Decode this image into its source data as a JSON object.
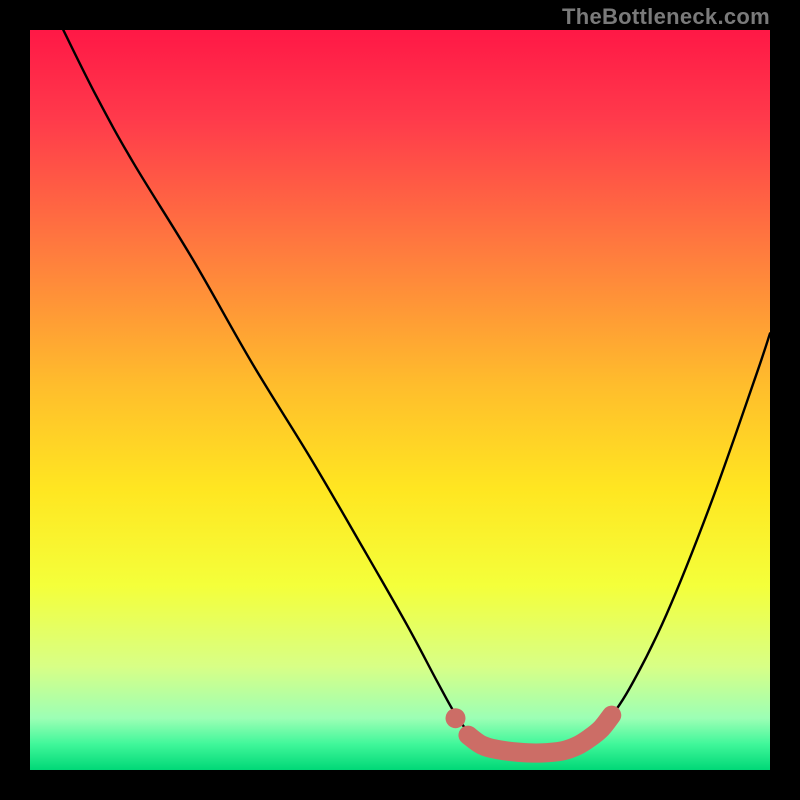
{
  "watermark": {
    "text": "TheBottleneck.com"
  },
  "chart_data": {
    "type": "line",
    "title": "",
    "xlabel": "",
    "ylabel": "",
    "xlim": [
      0,
      100
    ],
    "ylim": [
      0,
      100
    ],
    "grid": false,
    "legend": false,
    "background_gradient_stops": [
      {
        "offset": 0.0,
        "color": "#ff1846"
      },
      {
        "offset": 0.12,
        "color": "#ff3a4b"
      },
      {
        "offset": 0.3,
        "color": "#ff7c3e"
      },
      {
        "offset": 0.48,
        "color": "#ffbd2c"
      },
      {
        "offset": 0.62,
        "color": "#ffe621"
      },
      {
        "offset": 0.75,
        "color": "#f4ff3a"
      },
      {
        "offset": 0.86,
        "color": "#d8ff86"
      },
      {
        "offset": 0.93,
        "color": "#9cffb5"
      },
      {
        "offset": 0.965,
        "color": "#40f79a"
      },
      {
        "offset": 1.0,
        "color": "#00d877"
      }
    ],
    "curve_points": [
      {
        "x": 4.5,
        "y": 100.0
      },
      {
        "x": 9.0,
        "y": 91.0
      },
      {
        "x": 14.0,
        "y": 82.0
      },
      {
        "x": 22.0,
        "y": 69.0
      },
      {
        "x": 30.0,
        "y": 55.0
      },
      {
        "x": 38.0,
        "y": 42.0
      },
      {
        "x": 45.0,
        "y": 30.0
      },
      {
        "x": 51.0,
        "y": 19.5
      },
      {
        "x": 55.0,
        "y": 12.0
      },
      {
        "x": 57.5,
        "y": 7.5
      },
      {
        "x": 59.5,
        "y": 4.8
      },
      {
        "x": 61.0,
        "y": 3.5
      },
      {
        "x": 63.0,
        "y": 2.8
      },
      {
        "x": 66.0,
        "y": 2.4
      },
      {
        "x": 69.0,
        "y": 2.3
      },
      {
        "x": 72.0,
        "y": 2.6
      },
      {
        "x": 74.0,
        "y": 3.3
      },
      {
        "x": 75.5,
        "y": 4.2
      },
      {
        "x": 77.5,
        "y": 6.0
      },
      {
        "x": 81.0,
        "y": 11.0
      },
      {
        "x": 86.0,
        "y": 21.0
      },
      {
        "x": 92.0,
        "y": 36.0
      },
      {
        "x": 98.0,
        "y": 53.0
      },
      {
        "x": 100.0,
        "y": 59.0
      }
    ],
    "highlight": {
      "color": "#cc6d66",
      "dot": {
        "x": 57.5,
        "y": 7.0,
        "r": 1.35
      },
      "stroke_points": [
        {
          "x": 59.2,
          "y": 4.7
        },
        {
          "x": 61.0,
          "y": 3.4
        },
        {
          "x": 63.0,
          "y": 2.8
        },
        {
          "x": 66.0,
          "y": 2.4
        },
        {
          "x": 69.0,
          "y": 2.3
        },
        {
          "x": 72.0,
          "y": 2.6
        },
        {
          "x": 74.0,
          "y": 3.3
        },
        {
          "x": 75.6,
          "y": 4.3
        },
        {
          "x": 77.2,
          "y": 5.6
        },
        {
          "x": 78.6,
          "y": 7.4
        }
      ],
      "stroke_width": 2.6
    }
  }
}
